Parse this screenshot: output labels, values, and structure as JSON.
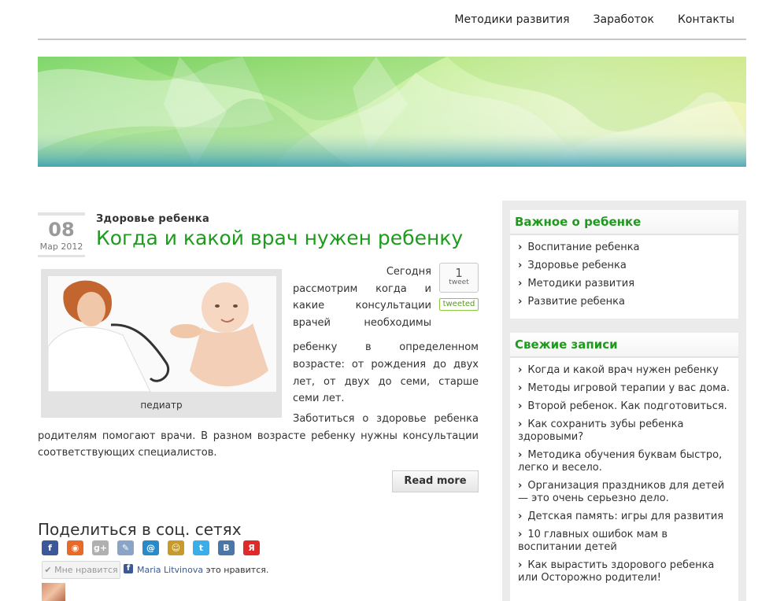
{
  "nav": {
    "items": [
      "Методики развития",
      "Заработок",
      "Контакты"
    ]
  },
  "post": {
    "day": "08",
    "month": "Мар 2012",
    "category": "Здоровье ребенка",
    "title": "Когда и какой врач нужен ребенку",
    "figure_caption": "педиатр",
    "paragraph1_lines": [
      "Сегодня",
      "рассмотрим когда и",
      "какие консультации",
      "врачей необходимы",
      "ребенку в определенном"
    ],
    "paragraph1_rest": "возрасте: от рождения до двух лет, от двух до семи, старше семи лет.",
    "paragraph2": "Заботиться о здоровье ребенка родителям помогают врачи. В разном возрасте ребенку нужны консультации соответствующих специалистов.",
    "tweet_count": "1",
    "tweet_label": "tweet",
    "tweeted_label": "tweeted",
    "read_more": "Read more"
  },
  "share": {
    "title": "Поделиться в соц. сетях",
    "icons": [
      {
        "name": "facebook-icon",
        "glyph": "f",
        "color": "#3b5998"
      },
      {
        "name": "chat-icon",
        "glyph": "◉",
        "color": "#e86a2b"
      },
      {
        "name": "google-plus-icon",
        "glyph": "g+",
        "color": "#b0b0b0"
      },
      {
        "name": "blog-icon",
        "glyph": "✎",
        "color": "#8aa4c8"
      },
      {
        "name": "mail-icon",
        "glyph": "@",
        "color": "#2a8ac8"
      },
      {
        "name": "odnoklassniki-icon",
        "glyph": "☺",
        "color": "#c89a2a"
      },
      {
        "name": "twitter-icon",
        "glyph": "t",
        "color": "#3aaee8"
      },
      {
        "name": "vkontakte-icon",
        "glyph": "В",
        "color": "#4a76a8"
      },
      {
        "name": "yandex-icon",
        "glyph": "Я",
        "color": "#e02a2a"
      }
    ],
    "like_button": "✔ Мне нравится",
    "liker_name": "Maria Litvinova",
    "like_suffix": " это нравится."
  },
  "sidebar": {
    "important": {
      "title": "Важное о ребенке",
      "items": [
        "Воспитание ребенка",
        "Здоровье ребенка",
        "Методики развития",
        "Развитие ребенка"
      ]
    },
    "recent": {
      "title": "Свежие записи",
      "items": [
        "Когда и какой врач нужен ребенку",
        "Методы игровой терапии у вас дома.",
        "Второй ребенок. Как подготовиться.",
        "Как сохранить зубы ребенка здоровыми?",
        "Методика обучения буквам быстро, легко и весело.",
        "Организация праздников для детей — это очень серьезно дело.",
        "Детская память: игры для развития",
        "10 главных ошибок мам в воспитании детей",
        "Как вырастить здорового ребенка или Осторожно родители!"
      ]
    }
  }
}
